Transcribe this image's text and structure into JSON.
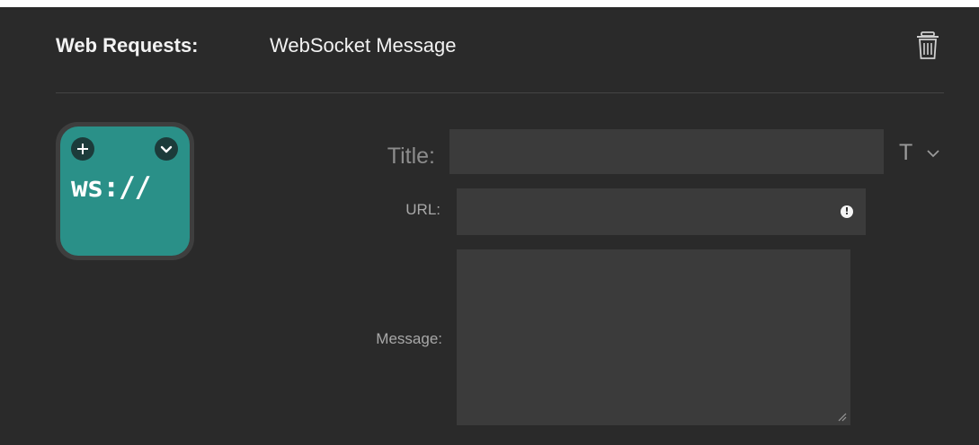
{
  "header": {
    "category": "Web Requests:",
    "action": "WebSocket Message"
  },
  "icon": {
    "text": "ws://",
    "tile_color": "#2a9088",
    "icons": [
      "plus-icon",
      "chevron-down-icon",
      "trash-icon"
    ]
  },
  "form": {
    "title_label": "Title:",
    "title_value": "",
    "title_type_indicator": "T",
    "url_label": "URL:",
    "url_value": "",
    "message_label": "Message:",
    "message_value": ""
  }
}
